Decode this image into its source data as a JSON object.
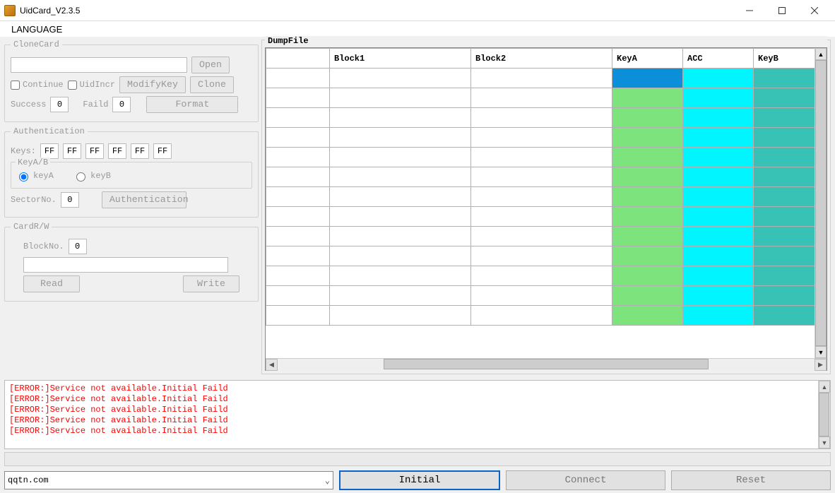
{
  "window": {
    "title": "UidCard_V2.3.5"
  },
  "menubar": {
    "language": "LANGUAGE"
  },
  "clonecard": {
    "legend": "CloneCard",
    "open": "Open",
    "continue": "Continue",
    "uidincr": "UidIncr",
    "modifykey": "ModifyKey",
    "clone": "Clone",
    "success_label": "Success",
    "success_value": "0",
    "faild_label": "Faild",
    "faild_value": "0",
    "format": "Format"
  },
  "auth": {
    "legend": "Authentication",
    "keys_label": "Keys:",
    "keys": [
      "FF",
      "FF",
      "FF",
      "FF",
      "FF",
      "FF"
    ],
    "keyab_legend": "KeyA/B",
    "keya": "keyA",
    "keyb": "keyB",
    "sectorno_label": "SectorNo.",
    "sectorno_value": "0",
    "auth_btn": "Authentication"
  },
  "cardrw": {
    "legend": "CardR/W",
    "blockno_label": "BlockNo.",
    "blockno_value": "0",
    "read": "Read",
    "write": "Write"
  },
  "dump": {
    "legend": "DumpFile",
    "headers": [
      "",
      "Block1",
      "Block2",
      "KeyA",
      "ACC",
      "KeyB"
    ],
    "rows": 13,
    "first_row_keya_blue": true
  },
  "log": {
    "lines": [
      "[ERROR:]Service not available.Initial Faild",
      "[ERROR:]Service not available.Initial Faild",
      "[ERROR:]Service not available.Initial Faild",
      "[ERROR:]Service not available.Initial Faild",
      "[ERROR:]Service not available.Initial Faild"
    ]
  },
  "bottom": {
    "combo_value": "qqtn.com",
    "initial": "Initial",
    "connect": "Connect",
    "reset": "Reset"
  }
}
